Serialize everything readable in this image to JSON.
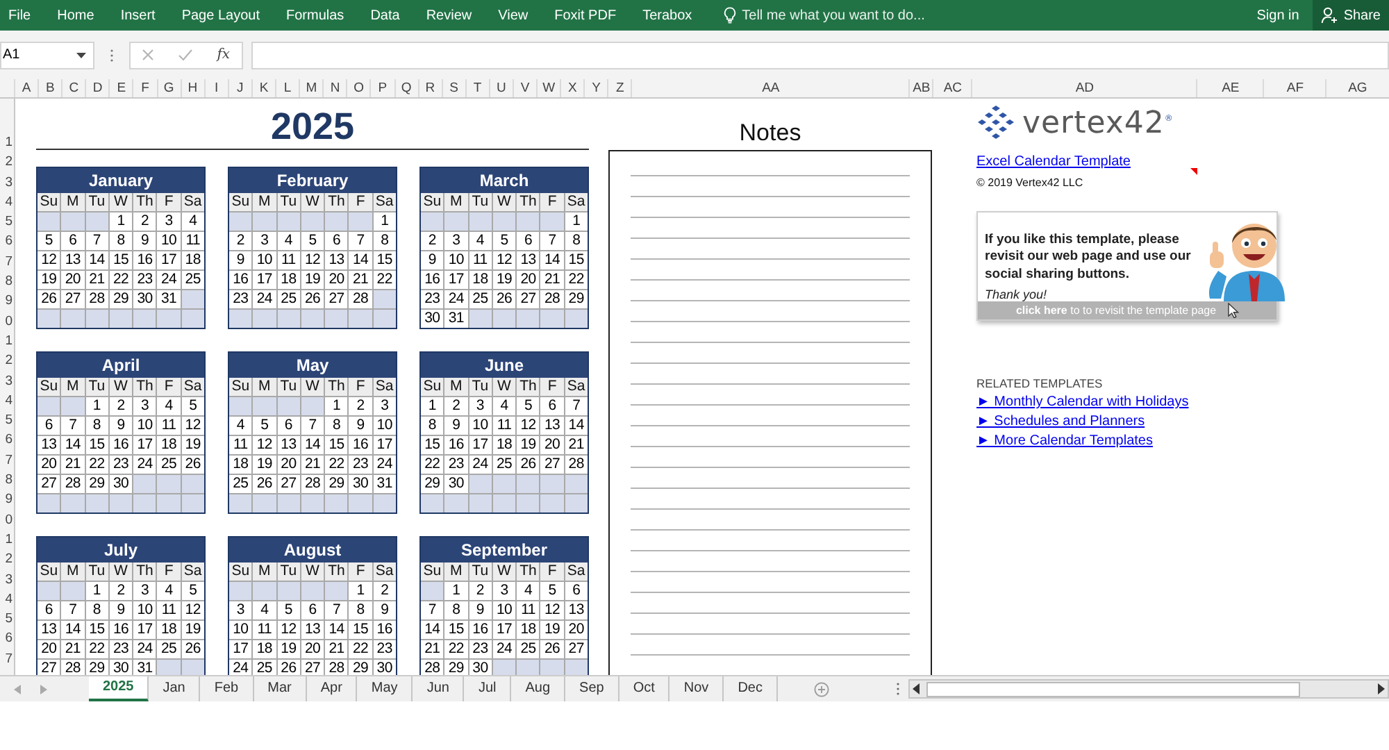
{
  "ribbon": {
    "tabs": [
      {
        "label": "File",
        "selected": false
      },
      {
        "label": "Home",
        "selected": false
      },
      {
        "label": "Insert",
        "selected": false
      },
      {
        "label": "Page Layout",
        "selected": false
      },
      {
        "label": "Formulas",
        "selected": false
      },
      {
        "label": "Data",
        "selected": false
      },
      {
        "label": "Review",
        "selected": false
      },
      {
        "label": "View",
        "selected": false
      },
      {
        "label": "Foxit PDF",
        "selected": false
      },
      {
        "label": "Terabox",
        "selected": false
      }
    ],
    "tell_me": "Tell me what you want to do...",
    "sign_in": "Sign in",
    "share": "Share"
  },
  "formula_bar": {
    "name_box": "A1",
    "function_button": "fx"
  },
  "column_headers": [
    "A",
    "B",
    "C",
    "D",
    "E",
    "F",
    "G",
    "H",
    "I",
    "J",
    "K",
    "L",
    "M",
    "N",
    "O",
    "P",
    "Q",
    "R",
    "S",
    "T",
    "U",
    "V",
    "W",
    "X",
    "Y",
    "Z",
    "AA",
    "AB",
    "AC",
    "AD",
    "AE",
    "AF",
    "AG"
  ],
  "row_headers": [
    "1",
    "2",
    "3",
    "4",
    "5",
    "6",
    "7",
    "8",
    "9",
    "0",
    "1",
    "2",
    "3",
    "4",
    "5",
    "6",
    "7",
    "8",
    "9",
    "0",
    "1",
    "2",
    "3",
    "4",
    "5",
    "6",
    "7"
  ],
  "year_title": "2025",
  "months": [
    {
      "name": "January",
      "weekdays": [
        "Su",
        "M",
        "Tu",
        "W",
        "Th",
        "F",
        "Sa"
      ],
      "weeks": [
        [
          {
            "kind": "blank"
          },
          {
            "kind": "blank"
          },
          {
            "kind": "blank"
          },
          {
            "kind": "day",
            "label": "1"
          },
          {
            "kind": "day",
            "label": "2"
          },
          {
            "kind": "day",
            "label": "3"
          },
          {
            "kind": "day",
            "label": "4"
          }
        ],
        [
          {
            "kind": "day",
            "label": "5"
          },
          {
            "kind": "day",
            "label": "6"
          },
          {
            "kind": "day",
            "label": "7"
          },
          {
            "kind": "day",
            "label": "8"
          },
          {
            "kind": "day",
            "label": "9"
          },
          {
            "kind": "day",
            "label": "10"
          },
          {
            "kind": "day",
            "label": "11"
          }
        ],
        [
          {
            "kind": "day",
            "label": "12"
          },
          {
            "kind": "day",
            "label": "13"
          },
          {
            "kind": "day",
            "label": "14"
          },
          {
            "kind": "day",
            "label": "15"
          },
          {
            "kind": "day",
            "label": "16"
          },
          {
            "kind": "day",
            "label": "17"
          },
          {
            "kind": "day",
            "label": "18"
          }
        ],
        [
          {
            "kind": "day",
            "label": "19"
          },
          {
            "kind": "day",
            "label": "20"
          },
          {
            "kind": "day",
            "label": "21"
          },
          {
            "kind": "day",
            "label": "22"
          },
          {
            "kind": "day",
            "label": "23"
          },
          {
            "kind": "day",
            "label": "24"
          },
          {
            "kind": "day",
            "label": "25"
          }
        ],
        [
          {
            "kind": "day",
            "label": "26"
          },
          {
            "kind": "day",
            "label": "27"
          },
          {
            "kind": "day",
            "label": "28"
          },
          {
            "kind": "day",
            "label": "29"
          },
          {
            "kind": "day",
            "label": "30"
          },
          {
            "kind": "day",
            "label": "31"
          },
          {
            "kind": "blank"
          }
        ],
        [
          {
            "kind": "blank"
          },
          {
            "kind": "blank"
          },
          {
            "kind": "blank"
          },
          {
            "kind": "blank"
          },
          {
            "kind": "blank"
          },
          {
            "kind": "blank"
          },
          {
            "kind": "blank"
          }
        ]
      ]
    },
    {
      "name": "February",
      "weekdays": [
        "Su",
        "M",
        "Tu",
        "W",
        "Th",
        "F",
        "Sa"
      ],
      "weeks": [
        [
          {
            "kind": "blank"
          },
          {
            "kind": "blank"
          },
          {
            "kind": "blank"
          },
          {
            "kind": "blank"
          },
          {
            "kind": "blank"
          },
          {
            "kind": "blank"
          },
          {
            "kind": "day",
            "label": "1"
          }
        ],
        [
          {
            "kind": "day",
            "label": "2"
          },
          {
            "kind": "day",
            "label": "3"
          },
          {
            "kind": "day",
            "label": "4"
          },
          {
            "kind": "day",
            "label": "5"
          },
          {
            "kind": "day",
            "label": "6"
          },
          {
            "kind": "day",
            "label": "7"
          },
          {
            "kind": "day",
            "label": "8"
          }
        ],
        [
          {
            "kind": "day",
            "label": "9"
          },
          {
            "kind": "day",
            "label": "10"
          },
          {
            "kind": "day",
            "label": "11"
          },
          {
            "kind": "day",
            "label": "12"
          },
          {
            "kind": "day",
            "label": "13"
          },
          {
            "kind": "day",
            "label": "14"
          },
          {
            "kind": "day",
            "label": "15"
          }
        ],
        [
          {
            "kind": "day",
            "label": "16"
          },
          {
            "kind": "day",
            "label": "17"
          },
          {
            "kind": "day",
            "label": "18"
          },
          {
            "kind": "day",
            "label": "19"
          },
          {
            "kind": "day",
            "label": "20"
          },
          {
            "kind": "day",
            "label": "21"
          },
          {
            "kind": "day",
            "label": "22"
          }
        ],
        [
          {
            "kind": "day",
            "label": "23"
          },
          {
            "kind": "day",
            "label": "24"
          },
          {
            "kind": "day",
            "label": "25"
          },
          {
            "kind": "day",
            "label": "26"
          },
          {
            "kind": "day",
            "label": "27"
          },
          {
            "kind": "day",
            "label": "28"
          },
          {
            "kind": "blank"
          }
        ],
        [
          {
            "kind": "blank"
          },
          {
            "kind": "blank"
          },
          {
            "kind": "blank"
          },
          {
            "kind": "blank"
          },
          {
            "kind": "blank"
          },
          {
            "kind": "blank"
          },
          {
            "kind": "blank"
          }
        ]
      ]
    },
    {
      "name": "March",
      "weekdays": [
        "Su",
        "M",
        "Tu",
        "W",
        "Th",
        "F",
        "Sa"
      ],
      "weeks": [
        [
          {
            "kind": "blank"
          },
          {
            "kind": "blank"
          },
          {
            "kind": "blank"
          },
          {
            "kind": "blank"
          },
          {
            "kind": "blank"
          },
          {
            "kind": "blank"
          },
          {
            "kind": "day",
            "label": "1"
          }
        ],
        [
          {
            "kind": "day",
            "label": "2"
          },
          {
            "kind": "day",
            "label": "3"
          },
          {
            "kind": "day",
            "label": "4"
          },
          {
            "kind": "day",
            "label": "5"
          },
          {
            "kind": "day",
            "label": "6"
          },
          {
            "kind": "day",
            "label": "7"
          },
          {
            "kind": "day",
            "label": "8"
          }
        ],
        [
          {
            "kind": "day",
            "label": "9"
          },
          {
            "kind": "day",
            "label": "10"
          },
          {
            "kind": "day",
            "label": "11"
          },
          {
            "kind": "day",
            "label": "12"
          },
          {
            "kind": "day",
            "label": "13"
          },
          {
            "kind": "day",
            "label": "14"
          },
          {
            "kind": "day",
            "label": "15"
          }
        ],
        [
          {
            "kind": "day",
            "label": "16"
          },
          {
            "kind": "day",
            "label": "17"
          },
          {
            "kind": "day",
            "label": "18"
          },
          {
            "kind": "day",
            "label": "19"
          },
          {
            "kind": "day",
            "label": "20"
          },
          {
            "kind": "day",
            "label": "21"
          },
          {
            "kind": "day",
            "label": "22"
          }
        ],
        [
          {
            "kind": "day",
            "label": "23"
          },
          {
            "kind": "day",
            "label": "24"
          },
          {
            "kind": "day",
            "label": "25"
          },
          {
            "kind": "day",
            "label": "26"
          },
          {
            "kind": "day",
            "label": "27"
          },
          {
            "kind": "day",
            "label": "28"
          },
          {
            "kind": "day",
            "label": "29"
          }
        ],
        [
          {
            "kind": "day",
            "label": "30"
          },
          {
            "kind": "day",
            "label": "31"
          },
          {
            "kind": "blank"
          },
          {
            "kind": "blank"
          },
          {
            "kind": "blank"
          },
          {
            "kind": "blank"
          },
          {
            "kind": "blank"
          }
        ]
      ]
    },
    {
      "name": "April",
      "weekdays": [
        "Su",
        "M",
        "Tu",
        "W",
        "Th",
        "F",
        "Sa"
      ],
      "weeks": [
        [
          {
            "kind": "blank"
          },
          {
            "kind": "blank"
          },
          {
            "kind": "day",
            "label": "1"
          },
          {
            "kind": "day",
            "label": "2"
          },
          {
            "kind": "day",
            "label": "3"
          },
          {
            "kind": "day",
            "label": "4"
          },
          {
            "kind": "day",
            "label": "5"
          }
        ],
        [
          {
            "kind": "day",
            "label": "6"
          },
          {
            "kind": "day",
            "label": "7"
          },
          {
            "kind": "day",
            "label": "8"
          },
          {
            "kind": "day",
            "label": "9"
          },
          {
            "kind": "day",
            "label": "10"
          },
          {
            "kind": "day",
            "label": "11"
          },
          {
            "kind": "day",
            "label": "12"
          }
        ],
        [
          {
            "kind": "day",
            "label": "13"
          },
          {
            "kind": "day",
            "label": "14"
          },
          {
            "kind": "day",
            "label": "15"
          },
          {
            "kind": "day",
            "label": "16"
          },
          {
            "kind": "day",
            "label": "17"
          },
          {
            "kind": "day",
            "label": "18"
          },
          {
            "kind": "day",
            "label": "19"
          }
        ],
        [
          {
            "kind": "day",
            "label": "20"
          },
          {
            "kind": "day",
            "label": "21"
          },
          {
            "kind": "day",
            "label": "22"
          },
          {
            "kind": "day",
            "label": "23"
          },
          {
            "kind": "day",
            "label": "24"
          },
          {
            "kind": "day",
            "label": "25"
          },
          {
            "kind": "day",
            "label": "26"
          }
        ],
        [
          {
            "kind": "day",
            "label": "27"
          },
          {
            "kind": "day",
            "label": "28"
          },
          {
            "kind": "day",
            "label": "29"
          },
          {
            "kind": "day",
            "label": "30"
          },
          {
            "kind": "blank"
          },
          {
            "kind": "blank"
          },
          {
            "kind": "blank"
          }
        ],
        [
          {
            "kind": "blank"
          },
          {
            "kind": "blank"
          },
          {
            "kind": "blank"
          },
          {
            "kind": "blank"
          },
          {
            "kind": "blank"
          },
          {
            "kind": "blank"
          },
          {
            "kind": "blank"
          }
        ]
      ]
    },
    {
      "name": "May",
      "weekdays": [
        "Su",
        "M",
        "Tu",
        "W",
        "Th",
        "F",
        "Sa"
      ],
      "weeks": [
        [
          {
            "kind": "blank"
          },
          {
            "kind": "blank"
          },
          {
            "kind": "blank"
          },
          {
            "kind": "blank"
          },
          {
            "kind": "day",
            "label": "1"
          },
          {
            "kind": "day",
            "label": "2"
          },
          {
            "kind": "day",
            "label": "3"
          }
        ],
        [
          {
            "kind": "day",
            "label": "4"
          },
          {
            "kind": "day",
            "label": "5"
          },
          {
            "kind": "day",
            "label": "6"
          },
          {
            "kind": "day",
            "label": "7"
          },
          {
            "kind": "day",
            "label": "8"
          },
          {
            "kind": "day",
            "label": "9"
          },
          {
            "kind": "day",
            "label": "10"
          }
        ],
        [
          {
            "kind": "day",
            "label": "11"
          },
          {
            "kind": "day",
            "label": "12"
          },
          {
            "kind": "day",
            "label": "13"
          },
          {
            "kind": "day",
            "label": "14"
          },
          {
            "kind": "day",
            "label": "15"
          },
          {
            "kind": "day",
            "label": "16"
          },
          {
            "kind": "day",
            "label": "17"
          }
        ],
        [
          {
            "kind": "day",
            "label": "18"
          },
          {
            "kind": "day",
            "label": "19"
          },
          {
            "kind": "day",
            "label": "20"
          },
          {
            "kind": "day",
            "label": "21"
          },
          {
            "kind": "day",
            "label": "22"
          },
          {
            "kind": "day",
            "label": "23"
          },
          {
            "kind": "day",
            "label": "24"
          }
        ],
        [
          {
            "kind": "day",
            "label": "25"
          },
          {
            "kind": "day",
            "label": "26"
          },
          {
            "kind": "day",
            "label": "27"
          },
          {
            "kind": "day",
            "label": "28"
          },
          {
            "kind": "day",
            "label": "29"
          },
          {
            "kind": "day",
            "label": "30"
          },
          {
            "kind": "day",
            "label": "31"
          }
        ],
        [
          {
            "kind": "blank"
          },
          {
            "kind": "blank"
          },
          {
            "kind": "blank"
          },
          {
            "kind": "blank"
          },
          {
            "kind": "blank"
          },
          {
            "kind": "blank"
          },
          {
            "kind": "blank"
          }
        ]
      ]
    },
    {
      "name": "June",
      "weekdays": [
        "Su",
        "M",
        "Tu",
        "W",
        "Th",
        "F",
        "Sa"
      ],
      "weeks": [
        [
          {
            "kind": "day",
            "label": "1"
          },
          {
            "kind": "day",
            "label": "2"
          },
          {
            "kind": "day",
            "label": "3"
          },
          {
            "kind": "day",
            "label": "4"
          },
          {
            "kind": "day",
            "label": "5"
          },
          {
            "kind": "day",
            "label": "6"
          },
          {
            "kind": "day",
            "label": "7"
          }
        ],
        [
          {
            "kind": "day",
            "label": "8"
          },
          {
            "kind": "day",
            "label": "9"
          },
          {
            "kind": "day",
            "label": "10"
          },
          {
            "kind": "day",
            "label": "11"
          },
          {
            "kind": "day",
            "label": "12"
          },
          {
            "kind": "day",
            "label": "13"
          },
          {
            "kind": "day",
            "label": "14"
          }
        ],
        [
          {
            "kind": "day",
            "label": "15"
          },
          {
            "kind": "day",
            "label": "16"
          },
          {
            "kind": "day",
            "label": "17"
          },
          {
            "kind": "day",
            "label": "18"
          },
          {
            "kind": "day",
            "label": "19"
          },
          {
            "kind": "day",
            "label": "20"
          },
          {
            "kind": "day",
            "label": "21"
          }
        ],
        [
          {
            "kind": "day",
            "label": "22"
          },
          {
            "kind": "day",
            "label": "23"
          },
          {
            "kind": "day",
            "label": "24"
          },
          {
            "kind": "day",
            "label": "25"
          },
          {
            "kind": "day",
            "label": "26"
          },
          {
            "kind": "day",
            "label": "27"
          },
          {
            "kind": "day",
            "label": "28"
          }
        ],
        [
          {
            "kind": "day",
            "label": "29"
          },
          {
            "kind": "day",
            "label": "30"
          },
          {
            "kind": "blank"
          },
          {
            "kind": "blank"
          },
          {
            "kind": "blank"
          },
          {
            "kind": "blank"
          },
          {
            "kind": "blank"
          }
        ],
        [
          {
            "kind": "blank"
          },
          {
            "kind": "blank"
          },
          {
            "kind": "blank"
          },
          {
            "kind": "blank"
          },
          {
            "kind": "blank"
          },
          {
            "kind": "blank"
          },
          {
            "kind": "blank"
          }
        ]
      ]
    },
    {
      "name": "July",
      "weekdays": [
        "Su",
        "M",
        "Tu",
        "W",
        "Th",
        "F",
        "Sa"
      ],
      "weeks": [
        [
          {
            "kind": "blank"
          },
          {
            "kind": "blank"
          },
          {
            "kind": "day",
            "label": "1"
          },
          {
            "kind": "day",
            "label": "2"
          },
          {
            "kind": "day",
            "label": "3"
          },
          {
            "kind": "day",
            "label": "4"
          },
          {
            "kind": "day",
            "label": "5"
          }
        ],
        [
          {
            "kind": "day",
            "label": "6"
          },
          {
            "kind": "day",
            "label": "7"
          },
          {
            "kind": "day",
            "label": "8"
          },
          {
            "kind": "day",
            "label": "9"
          },
          {
            "kind": "day",
            "label": "10"
          },
          {
            "kind": "day",
            "label": "11"
          },
          {
            "kind": "day",
            "label": "12"
          }
        ],
        [
          {
            "kind": "day",
            "label": "13"
          },
          {
            "kind": "day",
            "label": "14"
          },
          {
            "kind": "day",
            "label": "15"
          },
          {
            "kind": "day",
            "label": "16"
          },
          {
            "kind": "day",
            "label": "17"
          },
          {
            "kind": "day",
            "label": "18"
          },
          {
            "kind": "day",
            "label": "19"
          }
        ],
        [
          {
            "kind": "day",
            "label": "20"
          },
          {
            "kind": "day",
            "label": "21"
          },
          {
            "kind": "day",
            "label": "22"
          },
          {
            "kind": "day",
            "label": "23"
          },
          {
            "kind": "day",
            "label": "24"
          },
          {
            "kind": "day",
            "label": "25"
          },
          {
            "kind": "day",
            "label": "26"
          }
        ],
        [
          {
            "kind": "day",
            "label": "27"
          },
          {
            "kind": "day",
            "label": "28"
          },
          {
            "kind": "day",
            "label": "29"
          },
          {
            "kind": "day",
            "label": "30"
          },
          {
            "kind": "day",
            "label": "31"
          },
          {
            "kind": "blank"
          },
          {
            "kind": "blank"
          }
        ]
      ]
    },
    {
      "name": "August",
      "weekdays": [
        "Su",
        "M",
        "Tu",
        "W",
        "Th",
        "F",
        "Sa"
      ],
      "weeks": [
        [
          {
            "kind": "blank"
          },
          {
            "kind": "blank"
          },
          {
            "kind": "blank"
          },
          {
            "kind": "blank"
          },
          {
            "kind": "blank"
          },
          {
            "kind": "day",
            "label": "1"
          },
          {
            "kind": "day",
            "label": "2"
          }
        ],
        [
          {
            "kind": "day",
            "label": "3"
          },
          {
            "kind": "day",
            "label": "4"
          },
          {
            "kind": "day",
            "label": "5"
          },
          {
            "kind": "day",
            "label": "6"
          },
          {
            "kind": "day",
            "label": "7"
          },
          {
            "kind": "day",
            "label": "8"
          },
          {
            "kind": "day",
            "label": "9"
          }
        ],
        [
          {
            "kind": "day",
            "label": "10"
          },
          {
            "kind": "day",
            "label": "11"
          },
          {
            "kind": "day",
            "label": "12"
          },
          {
            "kind": "day",
            "label": "13"
          },
          {
            "kind": "day",
            "label": "14"
          },
          {
            "kind": "day",
            "label": "15"
          },
          {
            "kind": "day",
            "label": "16"
          }
        ],
        [
          {
            "kind": "day",
            "label": "17"
          },
          {
            "kind": "day",
            "label": "18"
          },
          {
            "kind": "day",
            "label": "19"
          },
          {
            "kind": "day",
            "label": "20"
          },
          {
            "kind": "day",
            "label": "21"
          },
          {
            "kind": "day",
            "label": "22"
          },
          {
            "kind": "day",
            "label": "23"
          }
        ],
        [
          {
            "kind": "day",
            "label": "24"
          },
          {
            "kind": "day",
            "label": "25"
          },
          {
            "kind": "day",
            "label": "26"
          },
          {
            "kind": "day",
            "label": "27"
          },
          {
            "kind": "day",
            "label": "28"
          },
          {
            "kind": "day",
            "label": "29"
          },
          {
            "kind": "day",
            "label": "30"
          }
        ]
      ]
    },
    {
      "name": "September",
      "weekdays": [
        "Su",
        "M",
        "Tu",
        "W",
        "Th",
        "F",
        "Sa"
      ],
      "weeks": [
        [
          {
            "kind": "blank"
          },
          {
            "kind": "day",
            "label": "1"
          },
          {
            "kind": "day",
            "label": "2"
          },
          {
            "kind": "day",
            "label": "3"
          },
          {
            "kind": "day",
            "label": "4"
          },
          {
            "kind": "day",
            "label": "5"
          },
          {
            "kind": "day",
            "label": "6"
          }
        ],
        [
          {
            "kind": "day",
            "label": "7"
          },
          {
            "kind": "day",
            "label": "8"
          },
          {
            "kind": "day",
            "label": "9"
          },
          {
            "kind": "day",
            "label": "10"
          },
          {
            "kind": "day",
            "label": "11"
          },
          {
            "kind": "day",
            "label": "12"
          },
          {
            "kind": "day",
            "label": "13"
          }
        ],
        [
          {
            "kind": "day",
            "label": "14"
          },
          {
            "kind": "day",
            "label": "15"
          },
          {
            "kind": "day",
            "label": "16"
          },
          {
            "kind": "day",
            "label": "17"
          },
          {
            "kind": "day",
            "label": "18"
          },
          {
            "kind": "day",
            "label": "19"
          },
          {
            "kind": "day",
            "label": "20"
          }
        ],
        [
          {
            "kind": "day",
            "label": "21"
          },
          {
            "kind": "day",
            "label": "22"
          },
          {
            "kind": "day",
            "label": "23"
          },
          {
            "kind": "day",
            "label": "24"
          },
          {
            "kind": "day",
            "label": "25"
          },
          {
            "kind": "day",
            "label": "26"
          },
          {
            "kind": "day",
            "label": "27"
          }
        ],
        [
          {
            "kind": "day",
            "label": "28"
          },
          {
            "kind": "day",
            "label": "29"
          },
          {
            "kind": "day",
            "label": "30"
          },
          {
            "kind": "blank"
          },
          {
            "kind": "blank"
          },
          {
            "kind": "blank"
          },
          {
            "kind": "blank"
          }
        ]
      ]
    }
  ],
  "notes": {
    "title": "Notes"
  },
  "side_panel": {
    "logo_text": "vertex42$^{®}$",
    "link": "Excel Calendar Template",
    "copyright": "© 2019 Vertex42 LLC",
    "promo": {
      "message": "If you like this template, please revisit our web page and use our social sharing buttons.",
      "thanks": "Thank you!",
      "action": "**click here** to to revisit the template page"
    },
    "related_heading": "RELATED TEMPLATES",
    "related_links": [
      "► Monthly Calendar with Holidays",
      "► Schedules and Planners",
      "► More Calendar Templates"
    ]
  },
  "sheet_tabs": [
    {
      "label": "2025",
      "selected": true
    },
    {
      "label": "Jan",
      "selected": false
    },
    {
      "label": "Feb",
      "selected": false
    },
    {
      "label": "Mar",
      "selected": false
    },
    {
      "label": "Apr",
      "selected": false
    },
    {
      "label": "May",
      "selected": false
    },
    {
      "label": "Jun",
      "selected": false
    },
    {
      "label": "Jul",
      "selected": false
    },
    {
      "label": "Aug",
      "selected": false
    },
    {
      "label": "Sep",
      "selected": false
    },
    {
      "label": "Oct",
      "selected": false
    },
    {
      "label": "Nov",
      "selected": false
    },
    {
      "label": "Dec",
      "selected": false
    }
  ]
}
